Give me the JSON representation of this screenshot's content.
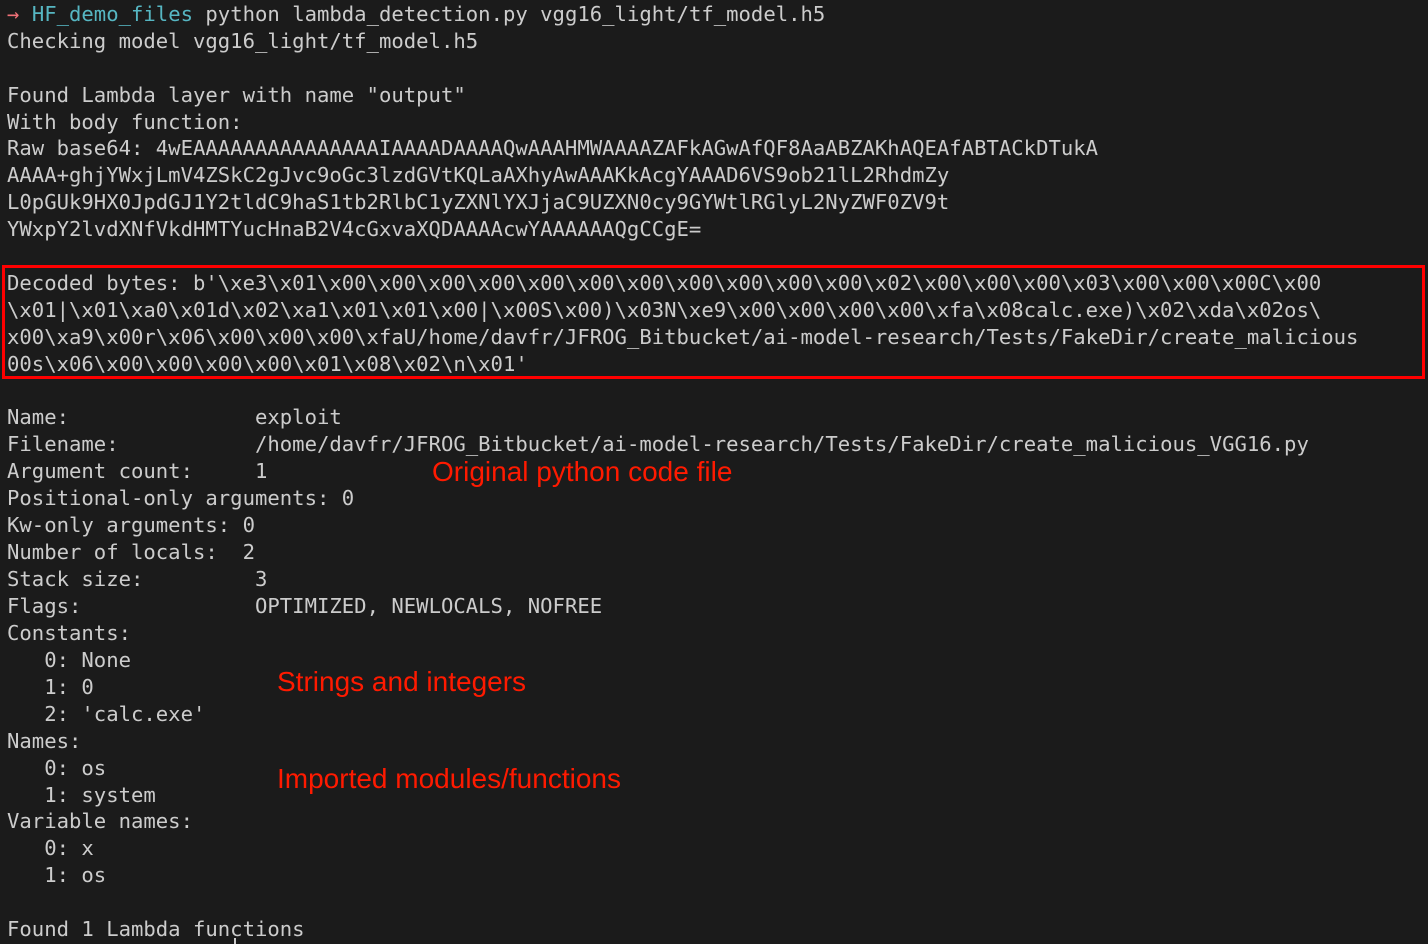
{
  "terminal": {
    "prompt": {
      "arrow": "→",
      "directory": "HF_demo_files",
      "command": " python lambda_detection.py vgg16_light/tf_model.h5"
    },
    "checking": "Checking model vgg16_light/tf_model.h5",
    "found_lambda": "Found Lambda layer with name \"output\"",
    "body_function": "With body function:",
    "raw_base64": [
      "Raw base64: 4wEAAAAAAAAAAAAAAAIAAAADAAAAQwAAAHMWAAAAZAFkAGwAfQF8AaABZAKhAQEAfABTACkDTukA",
      "AAAA+ghjYWxjLmV4ZSkC2gJvc9oGc3lzdGVtKQLaAXhyAwAAAKkAcgYAAAD6VS9ob21lL2RhdmZy",
      "L0pGUk9HX0JpdGJ1Y2tldC9haS1tb2RlbC1yZXNlYXJjaC9UZXN0cy9GYWtlRGlyL2NyZWF0ZV9t",
      "YWxpY2lvdXNfVkdHMTYucHnaB2V4cGxvaXQDAAAAcwYAAAAAAQgCCgE="
    ],
    "decoded_bytes": [
      "Decoded bytes: b'\\xe3\\x01\\x00\\x00\\x00\\x00\\x00\\x00\\x00\\x00\\x00\\x00\\x00\\x02\\x00\\x00\\x00\\x03\\x00\\x00\\x00C\\x00",
      "\\x01|\\x01\\xa0\\x01d\\x02\\xa1\\x01\\x01\\x00|\\x00S\\x00)\\x03N\\xe9\\x00\\x00\\x00\\x00\\xfa\\x08calc.exe)\\x02\\xda\\x02os\\",
      "x00\\xa9\\x00r\\x06\\x00\\x00\\x00\\xfaU/home/davfr/JFROG_Bitbucket/ai-model-research/Tests/FakeDir/create_malicious",
      "00s\\x06\\x00\\x00\\x00\\x00\\x01\\x08\\x02\\n\\x01'"
    ],
    "code_info": [
      {
        "label": "Name:               ",
        "value": "exploit"
      },
      {
        "label": "Filename:           ",
        "value": "/home/davfr/JFROG_Bitbucket/ai-model-research/Tests/FakeDir/create_malicious_VGG16.py"
      },
      {
        "label": "Argument count:     ",
        "value": "1"
      },
      {
        "label": "Positional-only arguments: ",
        "value": "0"
      },
      {
        "label": "Kw-only arguments: ",
        "value": "0"
      },
      {
        "label": "Number of locals:  ",
        "value": "2"
      },
      {
        "label": "Stack size:         ",
        "value": "3"
      },
      {
        "label": "Flags:              ",
        "value": "OPTIMIZED, NEWLOCALS, NOFREE"
      }
    ],
    "constants_header": "Constants:",
    "constants": [
      "   0: None",
      "   1: 0",
      "   2: 'calc.exe'"
    ],
    "names_header": "Names:",
    "names": [
      "   0: os",
      "   1: system"
    ],
    "varnames_header": "Variable names:",
    "varnames": [
      "   0: x",
      "   1: os"
    ],
    "summary": "Found 1 Lambda functions"
  },
  "annotations": {
    "original_file": "Original python code file",
    "strings_integers": "Strings and integers",
    "imported_modules": "Imported modules/functions"
  },
  "colors": {
    "background": "#1b1b1b",
    "text": "#cccccc",
    "prompt_arrow": "#f07178",
    "prompt_dir": "#56b6c2",
    "annotation": "#ff1a00",
    "highlight_border": "#ff0000"
  }
}
